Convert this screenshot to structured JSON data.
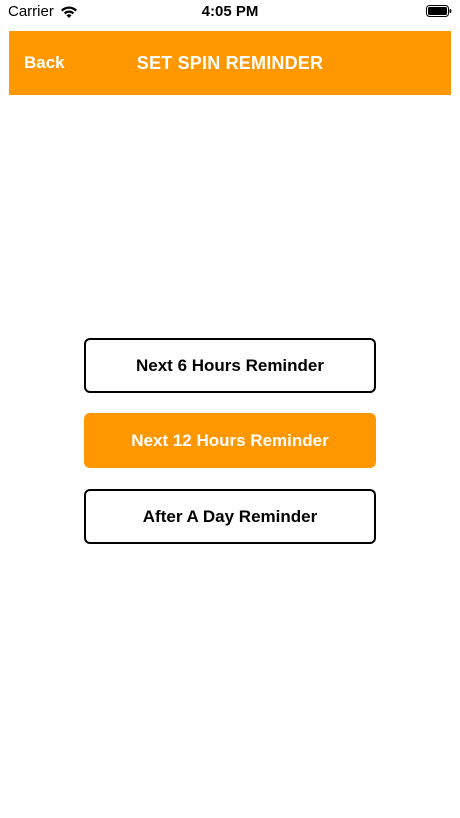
{
  "status_bar": {
    "carrier": "Carrier",
    "time": "4:05 PM",
    "wifi_icon": "wifi-icon",
    "battery_icon": "battery-full-icon"
  },
  "nav": {
    "back_label": "Back",
    "title": "SET SPIN REMINDER",
    "background_color": "#FF9800"
  },
  "reminder_options": [
    {
      "label": "Next 6 Hours Reminder",
      "selected": false
    },
    {
      "label": "Next 12 Hours Reminder",
      "selected": true
    },
    {
      "label": "After A Day Reminder",
      "selected": false
    }
  ],
  "colors": {
    "accent": "#FF9800",
    "outline": "#000000",
    "background": "#FFFFFF"
  }
}
